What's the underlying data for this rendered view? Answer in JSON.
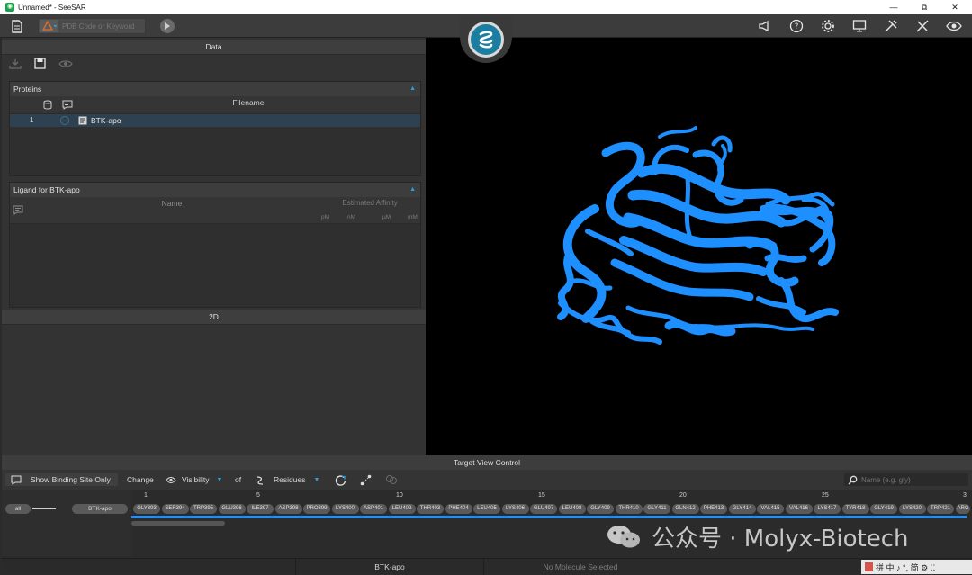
{
  "window": {
    "title": "Unnamed* - SeeSAR",
    "minimize": "—",
    "restore": "⧉",
    "close": "✕"
  },
  "toolbar": {
    "pdb_placeholder": "PDB Code or Keyword"
  },
  "left_panel": {
    "data_title": "Data",
    "proteins": {
      "header": "Proteins",
      "column_filename": "Filename",
      "rows": [
        {
          "index": "1",
          "name": "BTK-apo"
        }
      ]
    },
    "ligand": {
      "header": "Ligand for BTK-apo",
      "column_name": "Name",
      "column_affinity": "Estimated Affinity",
      "units": [
        "pM",
        "nM",
        "µM",
        "mM"
      ]
    },
    "section_2d": "2D"
  },
  "target_view": {
    "title": "Target View Control",
    "show_binding_site_only": "Show Binding Site Only",
    "change": "Change",
    "visibility": "Visibility",
    "of": "of",
    "residues": "Residues",
    "search_placeholder": "Name (e.g. gly)",
    "all_label": "all",
    "protein_label": "BTK-apo",
    "ticks": [
      "1",
      "5",
      "10",
      "15",
      "20",
      "25",
      "3"
    ],
    "residues_list": [
      "GLY393",
      "SER394",
      "TRP395",
      "GLU396",
      "ILE397",
      "ASP398",
      "PRO399",
      "LYS400",
      "ASP401",
      "LEU402",
      "THR403",
      "PHE404",
      "LEU405",
      "LYS406",
      "GLU407",
      "LEU408",
      "GLY409",
      "THR410",
      "GLY411",
      "GLN412",
      "PHE413",
      "GLY414",
      "VAL415",
      "VAL416",
      "LYS417",
      "TYR418",
      "GLY419",
      "LYS420",
      "TRP421",
      "ARG"
    ]
  },
  "status_bar": {
    "protein": "BTK-apo",
    "molecule": "No Molecule Selected"
  },
  "watermark": {
    "text": "公众号 · Molyx-Biotech"
  },
  "ime": {
    "text": "拼 中 ♪ °, 简 ⚙ ⁚⁚"
  },
  "colors": {
    "accent": "#29a3e0",
    "protein": "#1e8fff",
    "logo": "#1b7ea0"
  }
}
